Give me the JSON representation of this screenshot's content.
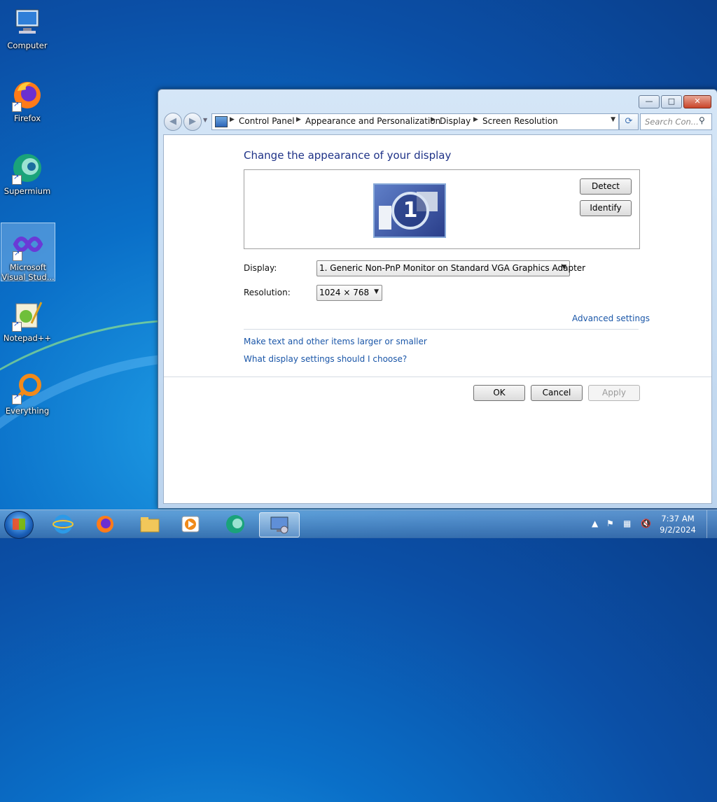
{
  "desktop": {
    "icons": [
      {
        "label": "Computer"
      },
      {
        "label": "Firefox"
      },
      {
        "label": "Supermium"
      },
      {
        "label": "Microsoft Visual Stud..."
      },
      {
        "label": "Notepad++"
      },
      {
        "label": "Everything"
      }
    ]
  },
  "window": {
    "controls": {
      "minimize": "—",
      "maximize": "□",
      "close": "✕"
    },
    "breadcrumb": [
      "Control Panel",
      "Appearance and Personalization",
      "Display",
      "Screen Resolution"
    ],
    "search_placeholder": "Search Con...",
    "heading": "Change the appearance of your display",
    "monitor_number": "1",
    "detect_label": "Detect",
    "identify_label": "Identify",
    "display_label": "Display:",
    "display_value": "1. Generic Non-PnP Monitor on Standard VGA Graphics Adapter",
    "resolution_label": "Resolution:",
    "resolution_value": "1024 × 768",
    "advanced_link": "Advanced settings",
    "link_larger": "Make text and other items larger or smaller",
    "link_help": "What display settings should I choose?",
    "ok_label": "OK",
    "cancel_label": "Cancel",
    "apply_label": "Apply"
  },
  "taskbar": {
    "time": "7:37 AM",
    "date": "9/2/2024",
    "items": [
      "internet-explorer",
      "firefox",
      "file-explorer",
      "media-player",
      "supermium",
      "control-panel-display"
    ]
  }
}
